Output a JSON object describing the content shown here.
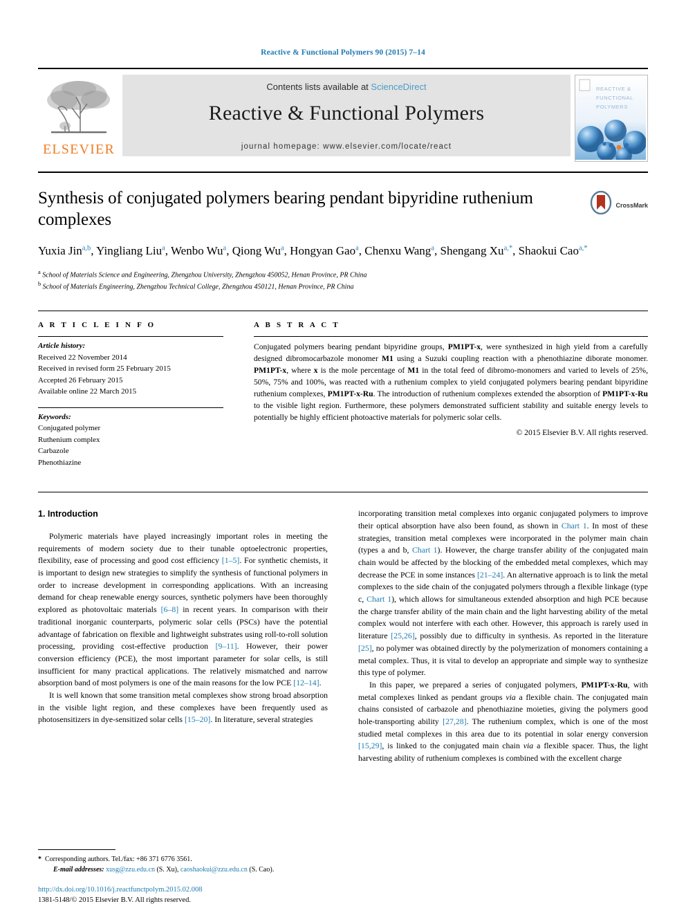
{
  "running_head": "Reactive & Functional Polymers 90 (2015) 7–14",
  "masthead": {
    "publisher_name": "ELSEVIER",
    "contents_prefix": "Contents lists available at",
    "contents_link": "ScienceDirect",
    "journal_title": "Reactive & Functional Polymers",
    "homepage": "journal homepage: www.elsevier.com/locate/react",
    "cover_line1": "REACTIVE &",
    "cover_line2": "FUNCTIONAL",
    "cover_line3": "POLYMERS"
  },
  "article": {
    "title": "Synthesis of conjugated polymers bearing pendant bipyridine ruthenium complexes",
    "crossmark_label": "CrossMark",
    "authors": [
      {
        "name": "Yuxia Jin",
        "sup": "a,b"
      },
      {
        "name": "Yingliang Liu",
        "sup": "a"
      },
      {
        "name": "Wenbo Wu",
        "sup": "a"
      },
      {
        "name": "Qiong Wu",
        "sup": "a"
      },
      {
        "name": "Hongyan Gao",
        "sup": "a"
      },
      {
        "name": "Chenxu Wang",
        "sup": "a"
      },
      {
        "name": "Shengang Xu",
        "sup": "a,*"
      },
      {
        "name": "Shaokui Cao",
        "sup": "a,*"
      }
    ],
    "affiliations": [
      {
        "sup": "a",
        "text": "School of Materials Science and Engineering, Zhengzhou University, Zhengzhou 450052, Henan Province, PR China"
      },
      {
        "sup": "b",
        "text": "School of Materials Engineering, Zhengzhou Technical College, Zhengzhou 450121, Henan Province, PR China"
      }
    ]
  },
  "info": {
    "heading": "A R T I C L E   I N F O",
    "history_label": "Article history:",
    "history": [
      "Received 22 November 2014",
      "Received in revised form 25 February 2015",
      "Accepted 26 February 2015",
      "Available online 22 March 2015"
    ],
    "keywords_label": "Keywords:",
    "keywords": [
      "Conjugated polymer",
      "Ruthenium complex",
      "Carbazole",
      "Phenothiazine"
    ]
  },
  "abstract": {
    "heading": "A B S T R A C T",
    "paragraph_html": "Conjugated polymers bearing pendant bipyridine groups, <b>PM1PT-x</b>, were synthesized in high yield from a carefully designed dibromocarbazole monomer <b>M1</b> using a Suzuki coupling reaction with a phenothiazine diborate monomer. <b>PM1PT-x</b>, where <b>x</b> is the mole percentage of <b>M1</b> in the total feed of dibromo-monomers and varied to levels of 25%, 50%, 75% and 100%, was reacted with a ruthenium complex to yield conjugated polymers bearing pendant bipyridine ruthenium complexes, <b>PM1PT-x-Ru</b>. The introduction of ruthenium complexes extended the absorption of <b>PM1PT-x-Ru</b> to the visible light region. Furthermore, these polymers demonstrated sufficient stability and suitable energy levels to potentially be highly efficient photoactive materials for polymeric solar cells.",
    "copyright": "© 2015 Elsevier B.V. All rights reserved."
  },
  "introduction": {
    "section_number_title": "1. Introduction",
    "left_paragraph_1_html": "Polymeric materials have played increasingly important roles in meeting the requirements of modern society due to their tunable optoelectronic properties, flexibility, ease of processing and good cost efficiency <span class=\"ref\">[1–5]</span>. For synthetic chemists, it is important to design new strategies to simplify the synthesis of functional polymers in order to increase development in corresponding applications. With an increasing demand for cheap renewable energy sources, synthetic polymers have been thoroughly explored as photovoltaic materials <span class=\"ref\">[6–8]</span> in recent years. In comparison with their traditional inorganic counterparts, polymeric solar cells (PSCs) have the potential advantage of fabrication on flexible and lightweight substrates using roll-to-roll solution processing, providing cost-effective production <span class=\"ref\">[9–11]</span>. However, their power conversion efficiency (PCE), the most important parameter for solar cells, is still insufficient for many practical applications. The relatively mismatched and narrow absorption band of most polymers is one of the main reasons for the low PCE <span class=\"ref\">[12–14]</span>.",
    "left_paragraph_2_html": "It is well known that some transition metal complexes show strong broad absorption in the visible light region, and these complexes have been frequently used as photosensitizers in dye-sensitized solar cells <span class=\"ref\">[15–20]</span>. In literature, several strategies",
    "right_paragraph_1_html": "incorporating transition metal complexes into organic conjugated polymers to improve their optical absorption have also been found, as shown in <span class=\"ref\">Chart 1</span>. In most of these strategies, transition metal complexes were incorporated in the polymer main chain (types a and b, <span class=\"ref\">Chart 1</span>). However, the charge transfer ability of the conjugated main chain would be affected by the blocking of the embedded metal complexes, which may decrease the PCE in some instances <span class=\"ref\">[21–24]</span>. An alternative approach is to link the metal complexes to the side chain of the conjugated polymers through a flexible linkage (type c, <span class=\"ref\">Chart 1</span>), which allows for simultaneous extended absorption and high PCE because the charge transfer ability of the main chain and the light harvesting ability of the metal complex would not interfere with each other. However, this approach is rarely used in literature <span class=\"ref\">[25,26]</span>, possibly due to difficulty in synthesis. As reported in the literature <span class=\"ref\">[25]</span>, no polymer was obtained directly by the polymerization of monomers containing a metal complex. Thus, it is vital to develop an appropriate and simple way to synthesize this type of polymer.",
    "right_paragraph_2_html": "In this paper, we prepared a series of conjugated polymers, <b>PM1PT-x-Ru</b>, with metal complexes linked as pendant groups <i>via</i> a flexible chain. The conjugated main chains consisted of carbazole and phenothiazine moieties, giving the polymers good hole-transporting ability <span class=\"ref\">[27,28]</span>. The ruthenium complex, which is one of the most studied metal complexes in this area due to its potential in solar energy conversion <span class=\"ref\">[15,29]</span>, is linked to the conjugated main chain <i>via</i> a flexible spacer. Thus, the light harvesting ability of ruthenium complexes is combined with the excellent charge"
  },
  "footnotes": {
    "corresponding_html": "<span class=\"star\">*</span>&nbsp; Corresponding authors. Tel./fax: +86 371 6776 3561.",
    "email_html": "<i>E-mail addresses:</i> <span class=\"mailto\">xusg@zzu.edu.cn</span> (S. Xu), <span class=\"mailto\">caoshaokui@zzu.edu.cn</span> (S. Cao).",
    "doi": "http://dx.doi.org/10.1016/j.reactfunctpolym.2015.02.008",
    "issn_line": "1381-5148/© 2015 Elsevier B.V. All rights reserved."
  },
  "colors": {
    "link_blue": "#1f7bb0",
    "sciencedirect_blue": "#4a9cc7",
    "elsevier_orange": "#ef7d22",
    "banner_gray": "#e3e3e3"
  }
}
